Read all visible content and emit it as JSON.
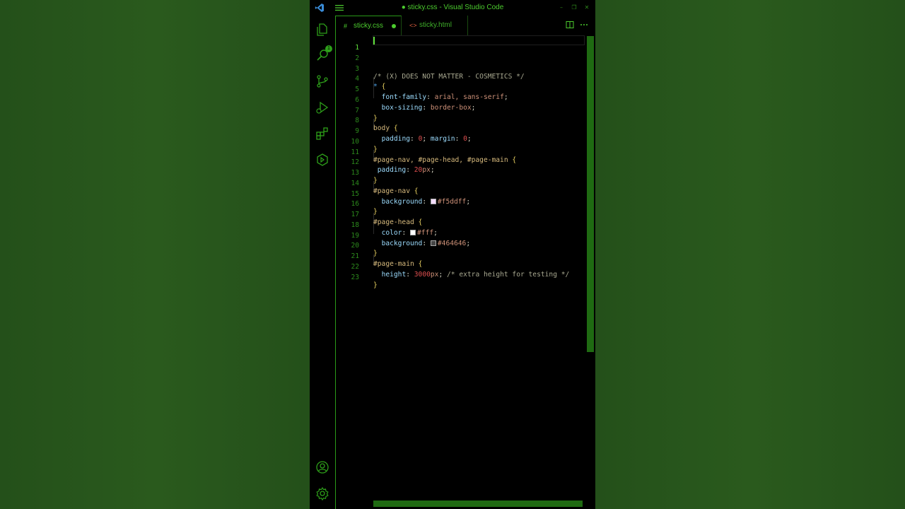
{
  "window": {
    "title": "● sticky.css - Visual Studio Code",
    "controls": [
      "–",
      "❐",
      "✕"
    ]
  },
  "activity_bar": {
    "items": [
      {
        "name": "explorer-icon",
        "badge": "1"
      },
      {
        "name": "search-icon"
      },
      {
        "name": "source-control-icon"
      },
      {
        "name": "run-debug-icon"
      },
      {
        "name": "extensions-icon"
      },
      {
        "name": "remote-icon"
      }
    ],
    "bottom": [
      {
        "name": "account-icon"
      },
      {
        "name": "settings-gear-icon"
      }
    ]
  },
  "tabs": [
    {
      "icon": "#",
      "label": "sticky.css",
      "active": true,
      "modified": true
    },
    {
      "icon": "<>",
      "label": "sticky.html",
      "active": false,
      "modified": false
    }
  ],
  "editor": {
    "current_line": "1",
    "line_numbers": [
      "1",
      "2",
      "3",
      "4",
      "5",
      "6",
      "7",
      "8",
      "9",
      "10",
      "11",
      "12",
      "13",
      "14",
      "15",
      "16",
      "17",
      "18",
      "19",
      "20",
      "21",
      "22",
      "23"
    ],
    "tokens": {
      "l3_comment": "/* (X) DOES NOT MATTER - COSMETICS */",
      "l4_sel": "*",
      "l5_prop": "font-family",
      "l5_val": "arial, sans-serif",
      "l6_prop": "box-sizing",
      "l6_val": "border-box",
      "l8_sel": "body",
      "l9_prop1": "padding",
      "l9_num1": "0",
      "l9_prop2": "margin",
      "l9_num2": "0",
      "l11_sel": "#page-nav, #page-head, #page-main",
      "l12_prop": "padding",
      "l12_num": "20",
      "l12_unit": "px",
      "l14_sel": "#page-nav",
      "l15_prop": "background",
      "l15_val": "#f5ddff",
      "l17_sel": "#page-head",
      "l18_prop": "color",
      "l18_val": "#fff",
      "l19_prop": "background",
      "l19_val": "#464646",
      "l21_sel": "#page-main",
      "l22_prop": "height",
      "l22_num": "3000",
      "l22_unit": "px",
      "l22_comment": "/* extra height for testing */"
    },
    "swatches": {
      "l15": "#f5ddff",
      "l18": "#ffffff",
      "l19": "#464646"
    }
  },
  "colors": {
    "accent": "#4ccc2e",
    "background_outer": "#265218",
    "scrollbar": "#1f6a12"
  }
}
